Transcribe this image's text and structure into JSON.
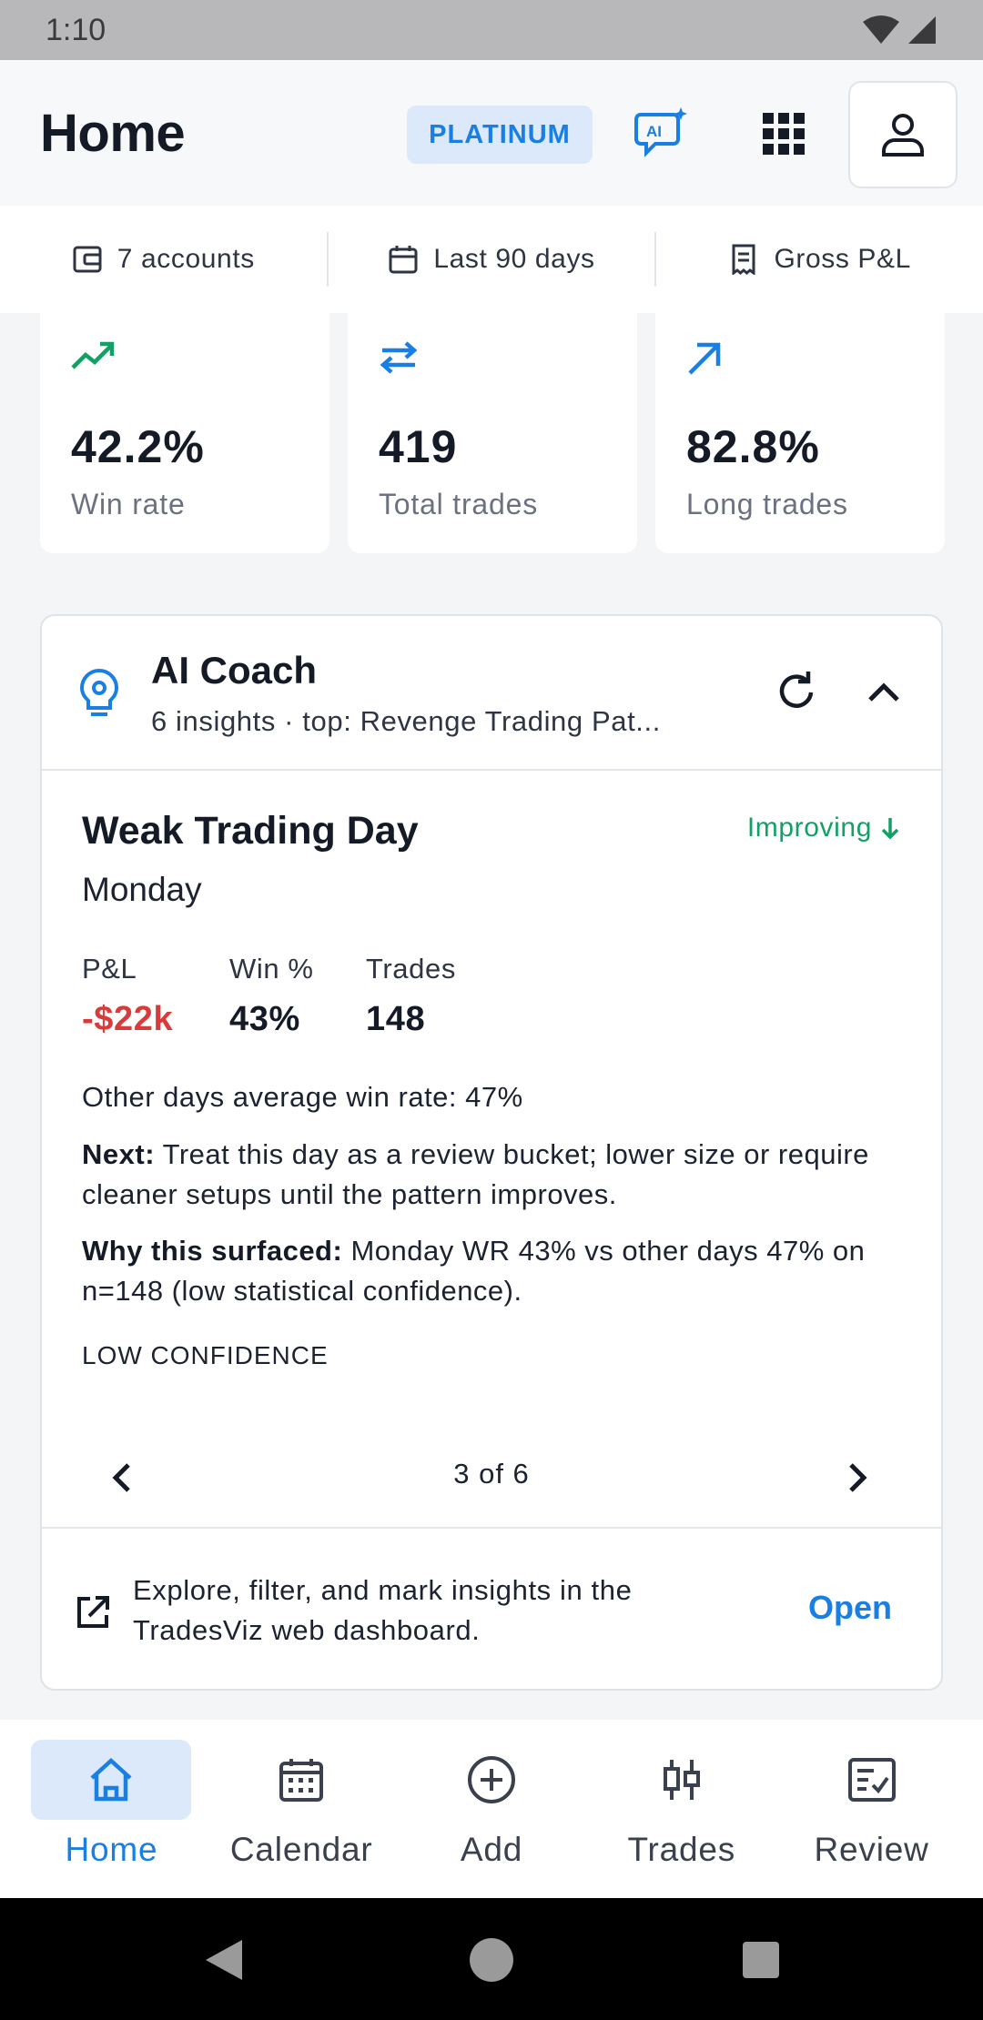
{
  "status_bar": {
    "time": "1:10"
  },
  "header": {
    "title": "Home",
    "badge": "PLATINUM",
    "ai_icon_text": "AI"
  },
  "filters": [
    {
      "label": "7 accounts",
      "icon": "wallet-icon"
    },
    {
      "label": "Last 90 days",
      "icon": "calendar-icon"
    },
    {
      "label": "Gross P&L",
      "icon": "receipt-icon"
    }
  ],
  "stats": [
    {
      "value": "42.2%",
      "label": "Win rate",
      "icon": "trending-up-icon",
      "color": "#13a067"
    },
    {
      "value": "419",
      "label": "Total trades",
      "icon": "swap-arrows-icon",
      "color": "#1a7fe3"
    },
    {
      "value": "82.8%",
      "label": "Long trades",
      "icon": "arrow-up-right-icon",
      "color": "#1a7fe3"
    }
  ],
  "coach": {
    "title": "AI Coach",
    "subtitle": "6 insights · top: Revenge Trading Pat...",
    "insight": {
      "title": "Weak Trading Day",
      "trend": "Improving",
      "day": "Monday",
      "metrics": [
        {
          "label": "P&L",
          "value": "-$22k",
          "color": "#d93a3a"
        },
        {
          "label": "Win %",
          "value": "43%",
          "color": "#141a26"
        },
        {
          "label": "Trades",
          "value": "148",
          "color": "#141a26"
        }
      ],
      "compare": "Other days average win rate: 47%",
      "next_label": "Next:",
      "next_text": " Treat this day as a review bucket; lower size or require cleaner setups until the pattern improves.",
      "why_label": "Why this surfaced:",
      "why_text": " Monday WR 43% vs other days 47% on n=148 (low statistical confidence).",
      "confidence": "LOW CONFIDENCE"
    },
    "pager": "3 of 6",
    "footer_text": "Explore, filter, and mark insights in the TradesViz web dashboard.",
    "footer_link": "Open"
  },
  "bottom_nav": [
    {
      "label": "Home",
      "icon": "home-icon",
      "active": true
    },
    {
      "label": "Calendar",
      "icon": "calendar-grid-icon",
      "active": false
    },
    {
      "label": "Add",
      "icon": "plus-circle-icon",
      "active": false
    },
    {
      "label": "Trades",
      "icon": "candlestick-icon",
      "active": false
    },
    {
      "label": "Review",
      "icon": "review-icon",
      "active": false
    }
  ],
  "colors": {
    "accent": "#1a7fe3",
    "positive": "#13a067",
    "negative": "#d93a3a"
  }
}
